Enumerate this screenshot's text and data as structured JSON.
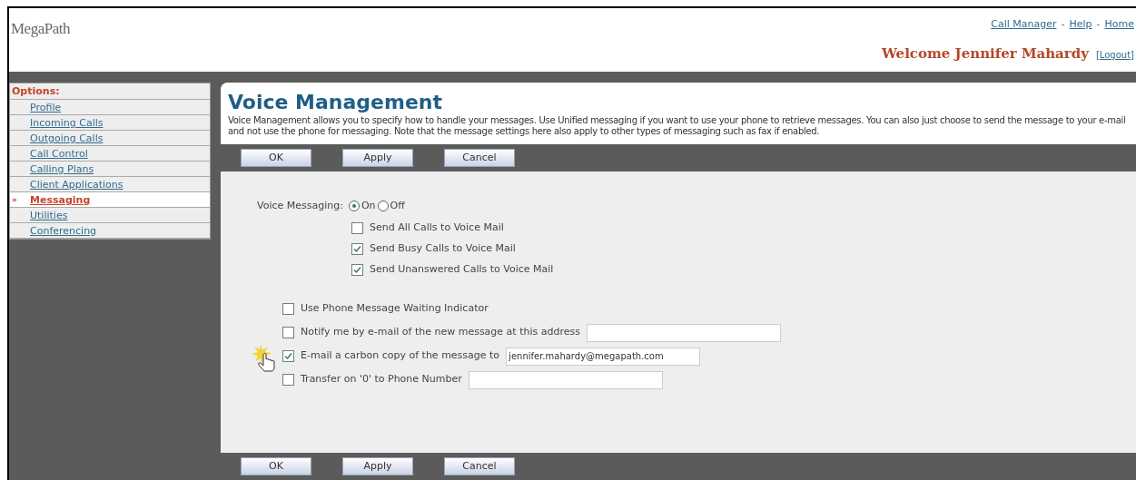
{
  "header": {
    "logo": "MegaPath",
    "top_links": [
      {
        "kind": "link",
        "label": "Call Manager"
      },
      {
        "kind": "separator",
        "label": "-"
      },
      {
        "kind": "link",
        "label": "Help"
      },
      {
        "kind": "separator",
        "label": "-"
      },
      {
        "kind": "link",
        "label": "Home"
      }
    ],
    "welcome": "Welcome Jennifer Mahardy",
    "logout": "[Logout]"
  },
  "sidebar": {
    "heading": "Options:",
    "marker": "»",
    "items": [
      {
        "label": "Profile",
        "selected": false
      },
      {
        "label": "Incoming Calls",
        "selected": false
      },
      {
        "label": "Outgoing Calls",
        "selected": false
      },
      {
        "label": "Call Control",
        "selected": false
      },
      {
        "label": "Calling Plans",
        "selected": false
      },
      {
        "label": "Client Applications",
        "selected": false
      },
      {
        "label": "Messaging",
        "selected": true
      },
      {
        "label": "Utilities",
        "selected": false
      },
      {
        "label": "Conferencing",
        "selected": false
      }
    ]
  },
  "content": {
    "title": "Voice Management",
    "description": "Voice Management allows you to specify how to handle your messages. Use Unified messaging if you want to use your phone to retrieve messages. You can also just choose to send the message to your e-mail and not use the phone for messaging. Note that the message settings here also apply to other types of messaging such as fax if enabled.",
    "top_buttons": [
      "OK",
      "Apply",
      "Cancel"
    ],
    "voice_messaging": {
      "label": "Voice Messaging:",
      "options": [
        {
          "label": "On",
          "selected": true
        },
        {
          "label": "Off",
          "selected": false
        }
      ],
      "checkboxes": [
        {
          "label": "Send All Calls to Voice Mail",
          "checked": false
        },
        {
          "label": "Send Busy Calls to Voice Mail",
          "checked": true
        },
        {
          "label": "Send Unanswered Calls to Voice Mail",
          "checked": true
        }
      ]
    },
    "options": [
      {
        "kind": "plain",
        "label": "Use Phone Message Waiting Indicator",
        "checked": false
      },
      {
        "kind": "field",
        "label": "Notify me by e-mail of the new message at this address",
        "checked": false
      },
      {
        "kind": "field",
        "label": "E-mail a carbon copy of the message to",
        "checked": true,
        "value": "jennifer.mahardy@megapath.com",
        "pointer": true
      },
      {
        "kind": "field",
        "label": "Transfer on '0' to Phone Number",
        "checked": false
      }
    ],
    "bottom_buttons": [
      "OK",
      "Apply",
      "Cancel"
    ]
  }
}
